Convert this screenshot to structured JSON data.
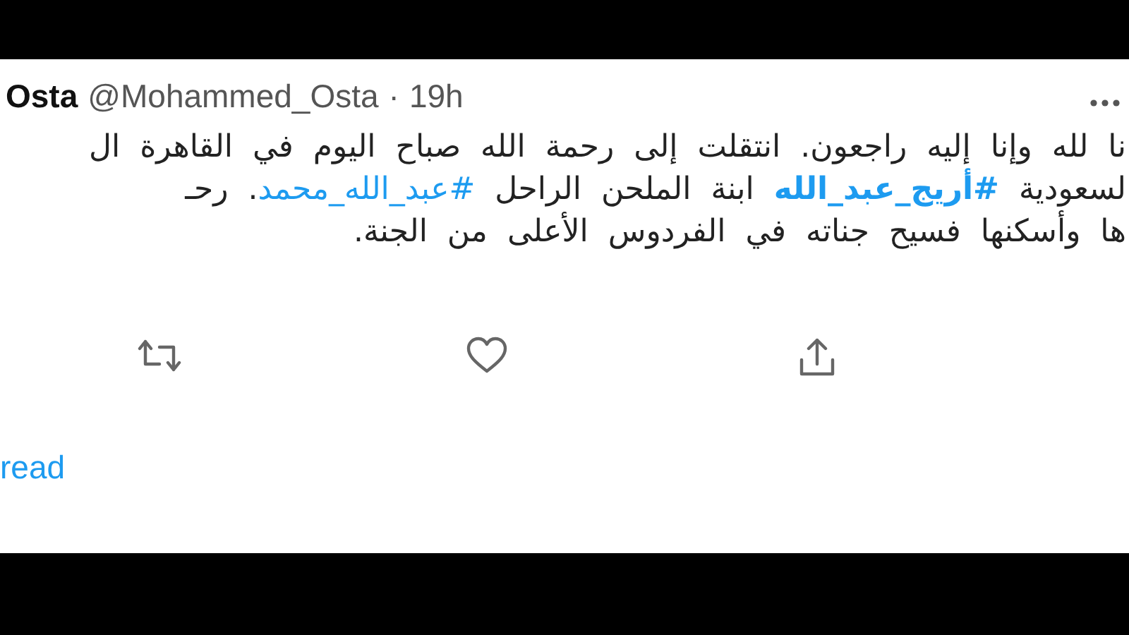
{
  "tweet": {
    "name": "Osta",
    "handle": "@Mohammed_Osta",
    "separator": "·",
    "time": "19h",
    "lines": [
      [
        {
          "kind": "text",
          "text": "نا لله وإنا إليه راجعون. انتقلت إلى رحمة الله صباح اليوم في القاهرة ال"
        }
      ],
      [
        {
          "kind": "text",
          "text": "لسعودية "
        },
        {
          "kind": "hashtag",
          "bold": true,
          "text": "#أريج_عبد_الله"
        },
        {
          "kind": "text",
          "text": " ابنة الملحن الراحل "
        },
        {
          "kind": "hashtag",
          "bold": false,
          "text": "#عبد_الله_محمد"
        },
        {
          "kind": "text",
          "text": ". رحـ"
        }
      ],
      [
        {
          "kind": "text",
          "text": "ها وأسكنها فسيح جناته في الفردوس الأعلى من الجنة."
        }
      ]
    ],
    "actions": [
      {
        "kind": "retweet"
      },
      {
        "kind": "like"
      },
      {
        "kind": "share"
      }
    ],
    "thread_link": "read"
  }
}
